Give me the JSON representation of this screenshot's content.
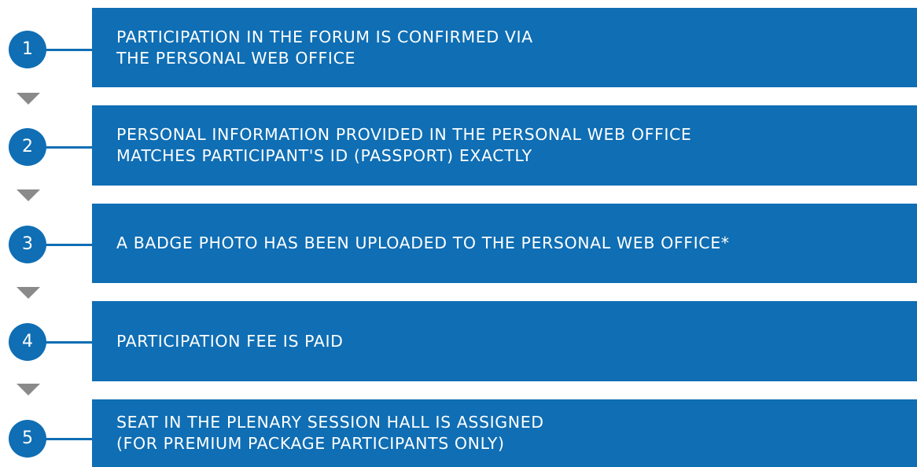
{
  "colors": {
    "primary": "#0f6eb4",
    "arrow": "#8a8a8a",
    "text_on_primary": "#ffffff"
  },
  "steps": [
    {
      "number": "1",
      "text": "PARTICIPATION IN THE FORUM IS CONFIRMED VIA\nTHE PERSONAL WEB OFFICE"
    },
    {
      "number": "2",
      "text": "PERSONAL INFORMATION PROVIDED IN THE PERSONAL WEB OFFICE\nMATCHES PARTICIPANT'S ID (PASSPORT) EXACTLY"
    },
    {
      "number": "3",
      "text": "A BADGE PHOTO HAS BEEN UPLOADED TO THE PERSONAL WEB OFFICE*"
    },
    {
      "number": "4",
      "text": "PARTICIPATION FEE IS PAID"
    },
    {
      "number": "5",
      "text": "SEAT IN THE PLENARY SESSION HALL IS ASSIGNED\n(FOR PREMIUM PACKAGE PARTICIPANTS ONLY)"
    }
  ]
}
